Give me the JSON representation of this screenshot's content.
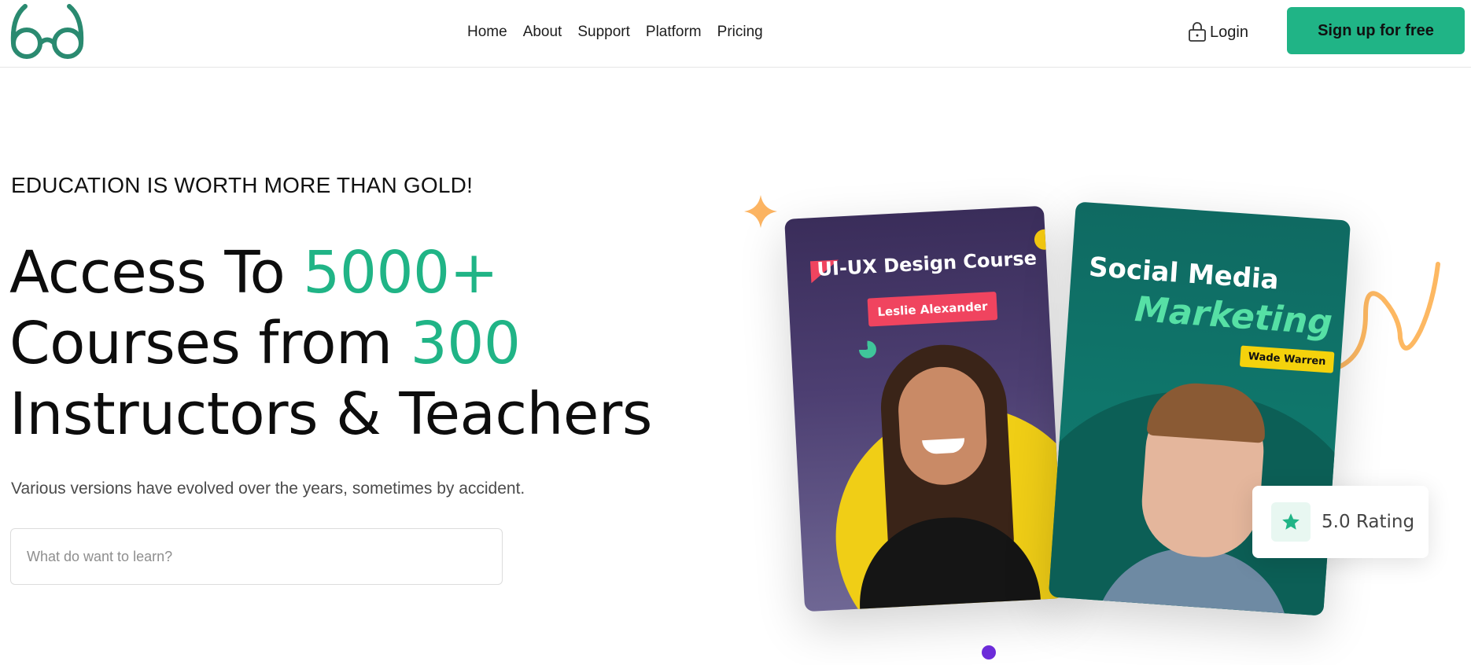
{
  "nav": {
    "items": [
      {
        "label": "Home"
      },
      {
        "label": "About"
      },
      {
        "label": "Support"
      },
      {
        "label": "Platform"
      },
      {
        "label": "Pricing"
      }
    ],
    "login_label": "Login",
    "signup_label": "Sign up for free"
  },
  "hero": {
    "eyebrow": "EDUCATION IS WORTH MORE THAN GOLD!",
    "headline": {
      "part1": "Access To ",
      "accent1": "5000+",
      "part2": " Courses from ",
      "accent2": "300",
      "part3": " Instructors & Teachers"
    },
    "subtext": "Various versions have evolved over the years, sometimes by accident.",
    "search_placeholder": "What do want to learn?"
  },
  "cards": {
    "card1": {
      "title": "UI-UX Design Course",
      "instructor": "Leslie Alexander"
    },
    "card2": {
      "title_line1": "Social Media",
      "title_line2": "Marketing",
      "instructor": "Wade Warren"
    }
  },
  "rating": {
    "value": "5.0",
    "label": "Rating"
  },
  "colors": {
    "accent": "#20b486",
    "card1_bg": "#3a2d5a",
    "card2_bg": "#0f6a62",
    "name_badge_red": "#f0445f",
    "name_badge_yellow": "#f4d20c",
    "pager_dot": "#6c2bd9"
  },
  "icons": {
    "logo": "glasses-logo",
    "login": "lock-icon",
    "rating": "star-icon",
    "decor1": "sparkle-icon",
    "decor2": "squiggle-decoration"
  }
}
